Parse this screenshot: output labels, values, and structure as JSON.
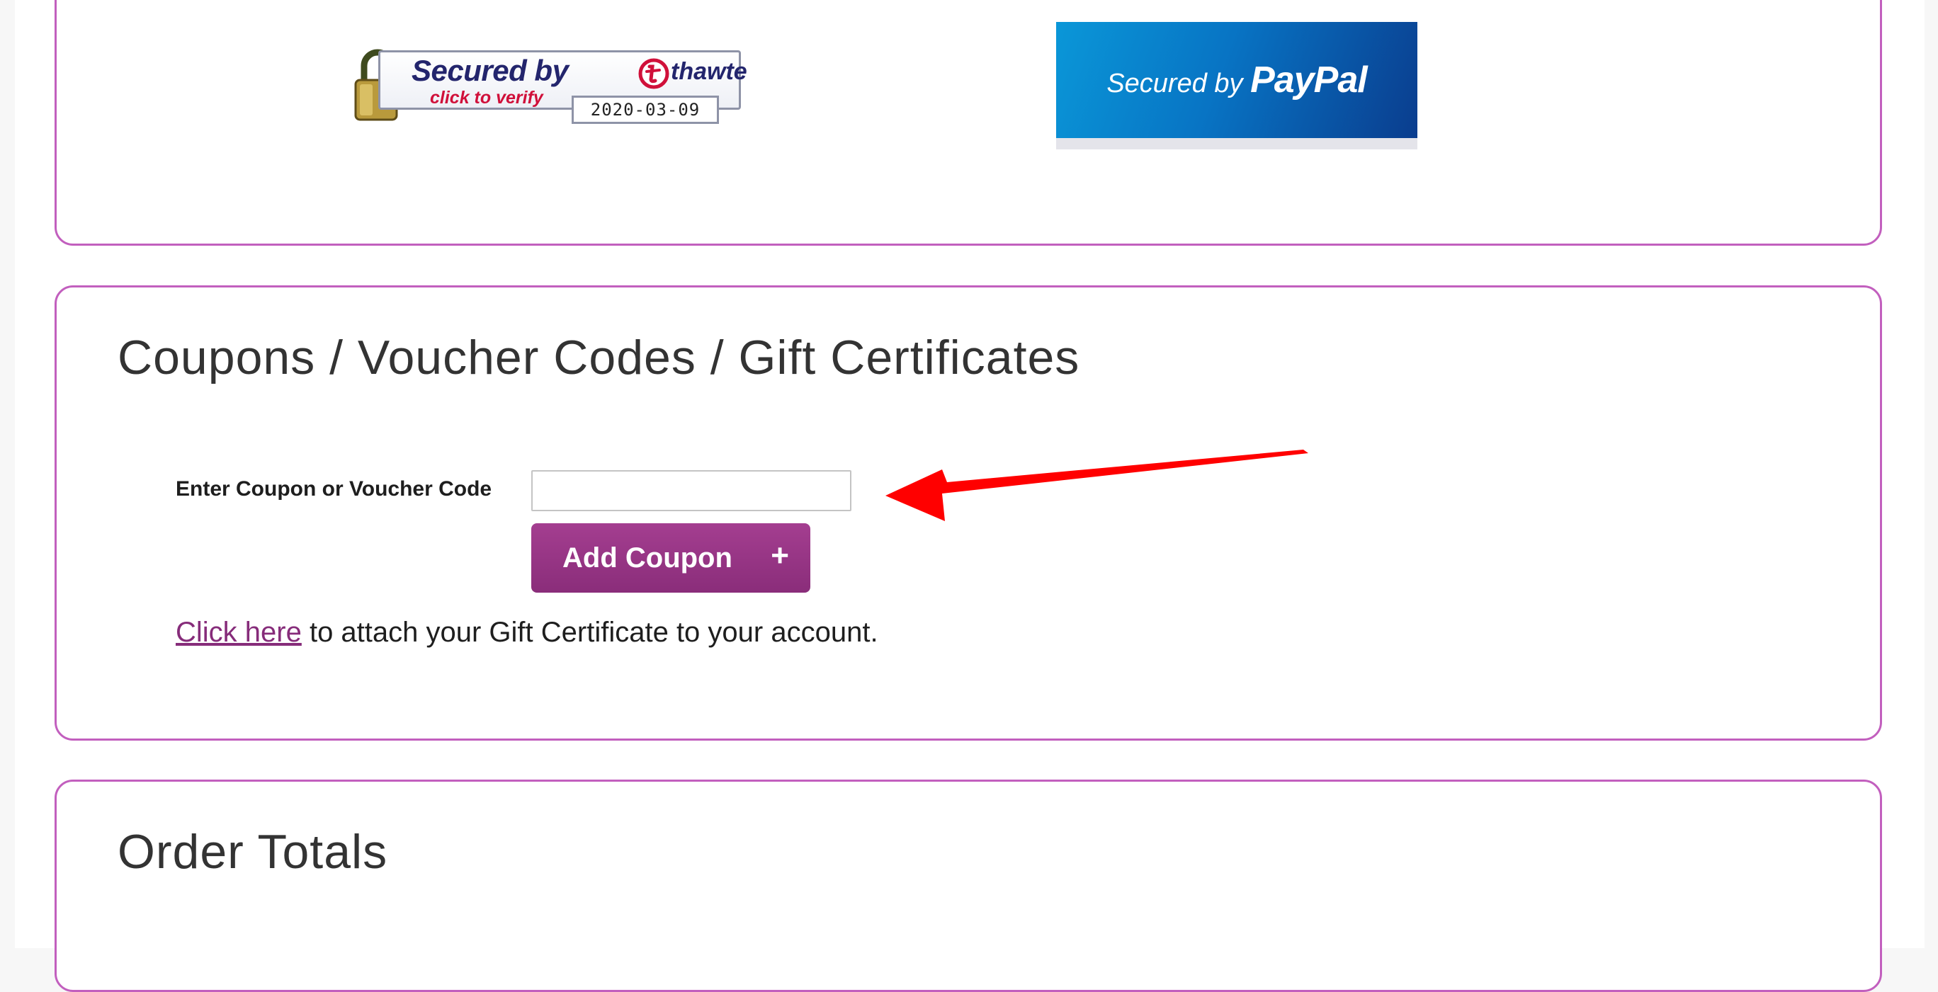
{
  "security": {
    "thawte": {
      "secured_label": "Secured by",
      "brand": "thawte",
      "click_label": "click to verify",
      "date": "2020-03-09"
    },
    "paypal": {
      "secured_label": "Secured by ",
      "brand": "PayPal"
    }
  },
  "coupons": {
    "title": "Coupons / Voucher Codes / Gift Certificates",
    "code_label": "Enter Coupon or Voucher Code",
    "code_value": "",
    "code_placeholder": "",
    "add_button_label": "Add Coupon",
    "add_button_icon": "+",
    "gift_link_text": "Click here",
    "gift_text": " to attach your Gift Certificate to your account."
  },
  "totals": {
    "title": "Order Totals"
  },
  "colors": {
    "panel_border": "#c25fbe",
    "button": "#9b3889",
    "link": "#862c7a",
    "annotation_arrow": "#ff0000",
    "paypal_blue": "#0874c4"
  }
}
